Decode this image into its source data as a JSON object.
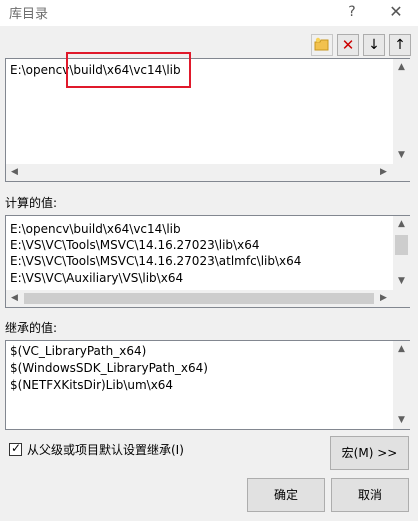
{
  "window": {
    "title": "库目录",
    "help_label": "?",
    "close_label": "✕"
  },
  "toolbar": {
    "new_line_icon": "new-folder-icon",
    "delete_icon": "delete-x-icon",
    "delete_label": "✕",
    "move_down_icon": "arrow-down-icon",
    "move_down_label": "↓",
    "move_up_icon": "arrow-up-icon",
    "move_up_label": "↑"
  },
  "edit": {
    "value": "E:\\opencv\\build\\x64\\vc14\\lib"
  },
  "evaluated": {
    "label": "计算的值:",
    "lines": [
      "E:\\opencv\\build\\x64\\vc14\\lib",
      "E:\\VS\\VC\\Tools\\MSVC\\14.16.27023\\lib\\x64",
      "E:\\VS\\VC\\Tools\\MSVC\\14.16.27023\\atlmfc\\lib\\x64",
      "E:\\VS\\VC\\Auxiliary\\VS\\lib\\x64"
    ]
  },
  "inherited": {
    "label": "继承的值:",
    "lines": [
      "$(VC_LibraryPath_x64)",
      "$(WindowsSDK_LibraryPath_x64)",
      "$(NETFXKitsDir)Lib\\um\\x64"
    ]
  },
  "inherit_checkbox": {
    "label": "从父级或项目默认设置继承(I)",
    "checked": true,
    "mark": "✓"
  },
  "buttons": {
    "macro": "宏(M) >>",
    "ok": "确定",
    "cancel": "取消"
  },
  "scroll": {
    "left": "◀",
    "right": "▶",
    "up": "▲",
    "down": "▼"
  },
  "colors": {
    "highlight": "#e0192b",
    "delete": "#cc0000"
  }
}
